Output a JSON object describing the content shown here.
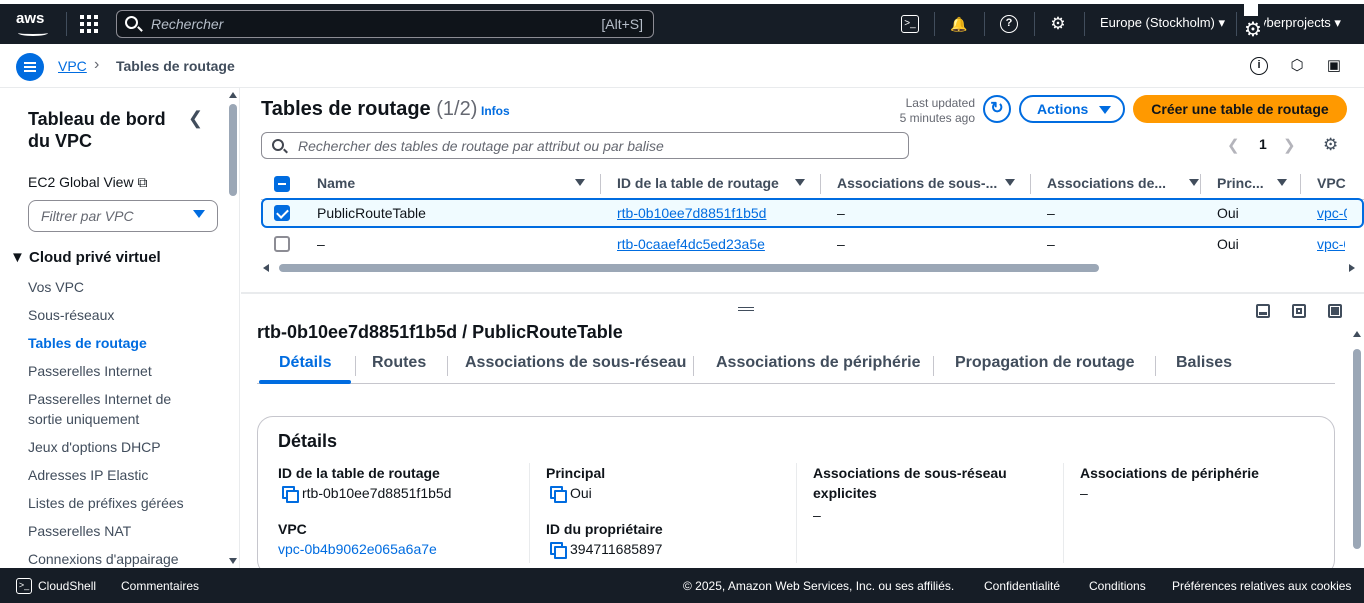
{
  "topbar": {
    "logo": "aws",
    "search_placeholder": "Rechercher",
    "search_shortcut": "[Alt+S]",
    "region": "Europe (Stockholm)",
    "account": "yberprojects"
  },
  "breadcrumb": {
    "root": "VPC",
    "separator": "›",
    "current": "Tables de routage"
  },
  "sidebar": {
    "title": "Tableau de bord du VPC",
    "ec2_global_view": "EC2 Global View",
    "filter_placeholder": "Filtrer par VPC",
    "section": "Cloud privé virtuel",
    "items": [
      {
        "label": "Vos VPC"
      },
      {
        "label": "Sous-réseaux"
      },
      {
        "label": "Tables de routage"
      },
      {
        "label": "Passerelles Internet"
      },
      {
        "label": "Passerelles Internet de sortie uniquement"
      },
      {
        "label": "Jeux d'options DHCP"
      },
      {
        "label": "Adresses IP Elastic"
      },
      {
        "label": "Listes de préfixes gérées"
      },
      {
        "label": "Passerelles NAT"
      },
      {
        "label": "Connexions d'appairage"
      }
    ]
  },
  "table": {
    "title": "Tables de routage",
    "count": "(1/2)",
    "info": "Infos",
    "last_updated_label": "Last updated",
    "last_updated_value": "5 minutes ago",
    "actions_label": "Actions",
    "create_label": "Créer une table de routage",
    "search_placeholder": "Rechercher des tables de routage par attribut ou par balise",
    "page": "1",
    "columns": [
      "Name",
      "ID de la table de routage",
      "Associations de sous-...",
      "Associations de...",
      "Princ...",
      "VPC"
    ],
    "rows": [
      {
        "name": "PublicRouteTable",
        "id": "rtb-0b10ee7d8851f1b5d",
        "subnet_assoc": "–",
        "edge_assoc": "–",
        "main": "Oui",
        "vpc": "vpc-0",
        "selected": true
      },
      {
        "name": "–",
        "id": "rtb-0caaef4dc5ed23a5e",
        "subnet_assoc": "–",
        "edge_assoc": "–",
        "main": "Oui",
        "vpc": "vpc-0",
        "selected": false
      }
    ]
  },
  "detail": {
    "title": "rtb-0b10ee7d8851f1b5d / PublicRouteTable",
    "tabs": [
      "Détails",
      "Routes",
      "Associations de sous-réseau",
      "Associations de périphérie",
      "Propagation de routage",
      "Balises"
    ],
    "card_title": "Détails",
    "route_table_id_label": "ID de la table de routage",
    "route_table_id": "rtb-0b10ee7d8851f1b5d",
    "vpc_label": "VPC",
    "vpc": "vpc-0b4b9062e065a6a7e",
    "main_label": "Principal",
    "main": "Oui",
    "owner_label": "ID du propriétaire",
    "owner": "394711685897",
    "explicit_subnet_label": "Associations de sous-réseau explicites",
    "explicit_subnet": "–",
    "edge_assoc_label": "Associations de périphérie",
    "edge_assoc": "–"
  },
  "footer": {
    "cloudshell": "CloudShell",
    "feedback": "Commentaires",
    "copyright": "© 2025, Amazon Web Services, Inc. ou ses affiliés.",
    "privacy": "Confidentialité",
    "terms": "Conditions",
    "cookies": "Préférences relatives aux cookies"
  },
  "colors": {
    "accent": "#006ce0",
    "primary_button": "#ff9900",
    "header_bg": "#161d26"
  }
}
